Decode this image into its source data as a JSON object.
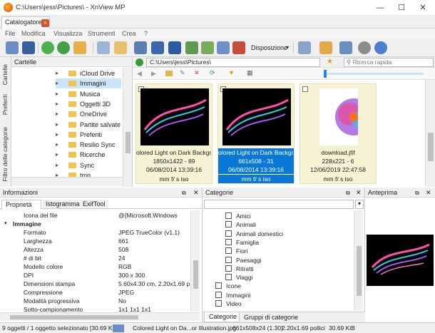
{
  "window": {
    "title": "C:\\Users\\jess\\Pictures\\ - XnView MP",
    "minimize": "—",
    "maximize": "☐",
    "close": "✕"
  },
  "tab": {
    "label": "Catalogatore",
    "close": "×"
  },
  "menu": [
    "File",
    "Modifica",
    "Visualizza",
    "Strumenti",
    "Crea",
    "?"
  ],
  "toolbar": {
    "layout_label": "Disposizione"
  },
  "sidebar_tabs": [
    "Cartelle",
    "Preferiti",
    "Filtro delle categorie"
  ],
  "folders": {
    "title": "Cartelle",
    "items": [
      {
        "label": "iCloud Drive",
        "selected": false
      },
      {
        "label": "Immagini",
        "selected": true
      },
      {
        "label": "Musica",
        "selected": false
      },
      {
        "label": "Oggetti 3D",
        "selected": false
      },
      {
        "label": "OneDrive",
        "selected": false
      },
      {
        "label": "Partite salvate",
        "selected": false
      },
      {
        "label": "Preferiti",
        "selected": false
      },
      {
        "label": "Resilio Sync",
        "selected": false
      },
      {
        "label": "Ricerche",
        "selected": false
      },
      {
        "label": "Sync",
        "selected": false
      },
      {
        "label": "tmp",
        "selected": false
      }
    ]
  },
  "browser": {
    "path": "C:\\Users\\jess\\Pictures\\",
    "search_placeholder": "Ricerca rapida",
    "thumbs": [
      {
        "name": "olored Light on Dark Backgr...",
        "dims": "1850x1422 - 89",
        "date": "06/08/2014 13:39:16",
        "extra": "mm f/ s iso",
        "selected": false
      },
      {
        "name": "olored Light on Dark Backgr...",
        "dims": "661x508 - 31",
        "date": "06/08/2014 13:39:16",
        "extra": "mm f/ s iso",
        "selected": true
      },
      {
        "name": "download.jfif",
        "dims": "228x221 - 6",
        "date": "12/06/2019 22:47:58",
        "extra": "mm f/ s iso",
        "selected": false
      }
    ]
  },
  "info": {
    "title": "Informazioni",
    "tabs": [
      "Proprietà",
      "Istogramma",
      "ExifTool"
    ],
    "rows": [
      {
        "k": "Icona del file",
        "v": "@{Microsoft.Windows",
        "group": false
      },
      {
        "k": "Immagine",
        "v": "",
        "group": true
      },
      {
        "k": "Formato",
        "v": "JPEG TrueColor (v1.1)",
        "group": false
      },
      {
        "k": "Larghezza",
        "v": "661",
        "group": false
      },
      {
        "k": "Altezza",
        "v": "508",
        "group": false
      },
      {
        "k": "# di bit",
        "v": "24",
        "group": false
      },
      {
        "k": "Modello colore",
        "v": "RGB",
        "group": false
      },
      {
        "k": "DPI",
        "v": "300 x 300",
        "group": false
      },
      {
        "k": "Dimensioni stampa",
        "v": "5.60x4.30 cm, 2.20x1.69 po",
        "group": false
      },
      {
        "k": "Compressione",
        "v": "JPEG",
        "group": false
      },
      {
        "k": "Modalità progressiva",
        "v": "No",
        "group": false
      },
      {
        "k": "Sotto-campionamento",
        "v": "1x1 1x1 1x1",
        "group": false
      }
    ]
  },
  "categories": {
    "title": "Categorie",
    "items": [
      {
        "label": "Amici",
        "indent": 2
      },
      {
        "label": "Animali",
        "indent": 2
      },
      {
        "label": "Animali domestici",
        "indent": 2
      },
      {
        "label": "Famiglia",
        "indent": 2
      },
      {
        "label": "Fiori",
        "indent": 2
      },
      {
        "label": "Paesaggi",
        "indent": 2
      },
      {
        "label": "Ritratti",
        "indent": 2
      },
      {
        "label": "Viaggi",
        "indent": 2
      },
      {
        "label": "Icone",
        "indent": 1
      },
      {
        "label": "Immagini",
        "indent": 1
      },
      {
        "label": "Video",
        "indent": 1
      }
    ],
    "bottom_tabs": [
      "Categorie",
      "Gruppi di categorie"
    ]
  },
  "preview": {
    "title": "Anteprima"
  },
  "status": {
    "count": "9 oggetti / 1 oggetto selezionato [30.69 KiB]",
    "file": "Colored Light on Da...or Illustration.jpg",
    "dims": "661x508x24 (1.30)",
    "inches": "2.20x1.69 pollici",
    "size": "30.69 KiB"
  }
}
